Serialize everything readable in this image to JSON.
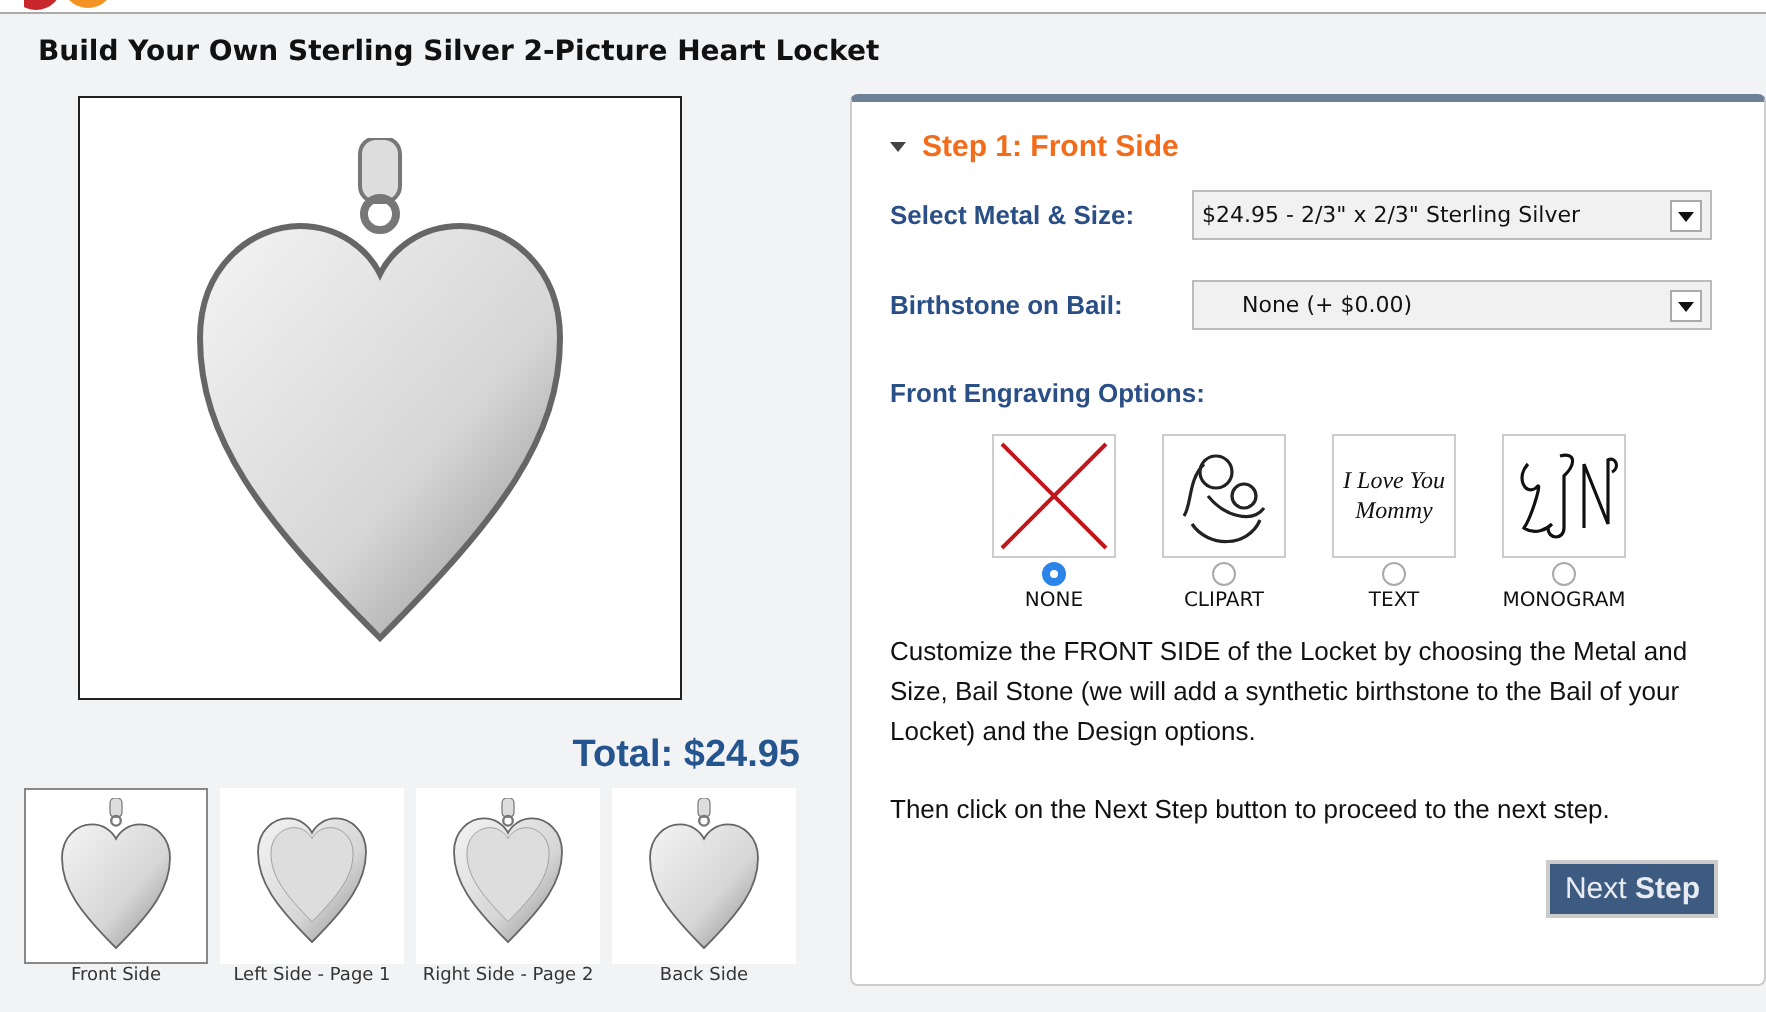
{
  "page_title": "Build Your Own Sterling Silver 2-Picture Heart Locket",
  "total": "Total: $24.95",
  "thumbnails": [
    {
      "caption": "Front Side",
      "selected": true,
      "kind": "front"
    },
    {
      "caption": "Left Side - Page 1",
      "selected": false,
      "kind": "left"
    },
    {
      "caption": "Right Side - Page 2",
      "selected": false,
      "kind": "right"
    },
    {
      "caption": "Back Side",
      "selected": false,
      "kind": "back"
    }
  ],
  "step": {
    "title": "Step 1: Front Side",
    "expanded": true
  },
  "fields": [
    {
      "label": "Select Metal & Size:",
      "value": "$24.95 - 2/3\" x 2/3\" Sterling Silver"
    },
    {
      "label": "Birthstone on Bail:",
      "value": "None (+ $0.00)"
    }
  ],
  "engraving": {
    "label": "Front Engraving Options:",
    "options": [
      {
        "kind": "none",
        "label": "NONE",
        "selected": true
      },
      {
        "kind": "clipart",
        "label": "CLIPART",
        "selected": false
      },
      {
        "kind": "text",
        "label": "TEXT",
        "selected": false,
        "preview_text": "I Love You Mommy"
      },
      {
        "kind": "monogram",
        "label": "MONOGRAM",
        "selected": false
      }
    ]
  },
  "paragraphs": [
    "Customize the FRONT SIDE of the Locket by choosing the Metal and Size, Bail Stone (we will add a synthetic birthstone to the Bail of your Locket) and the Design options.",
    "Then click on the Next Step button to proceed to the next step."
  ],
  "next_button": "Next **Step**"
}
